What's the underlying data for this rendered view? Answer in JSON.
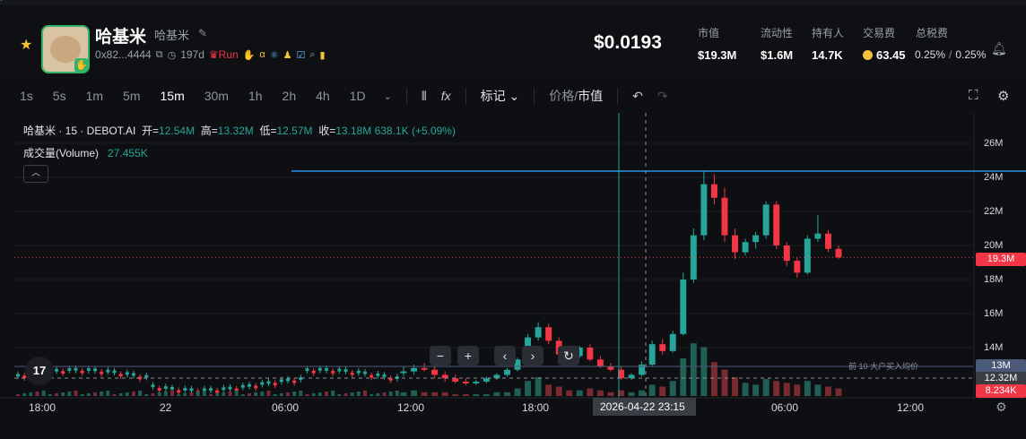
{
  "header": {
    "name": "哈基米",
    "sub_name": "哈基米",
    "address": "0x82...4444",
    "age": "197d",
    "run_label": "Run",
    "price": "$0.0193",
    "stats": [
      {
        "label": "市值",
        "value": "$19.3M"
      },
      {
        "label": "流动性",
        "value": "$1.6M"
      },
      {
        "label": "持有人",
        "value": "14.7K"
      },
      {
        "label": "交易费",
        "value": "63.45"
      },
      {
        "label": "总税费",
        "value": "0.25%",
        "value2": "0.25%"
      }
    ]
  },
  "toolbar": {
    "timeframes": [
      "1s",
      "5s",
      "1m",
      "5m",
      "15m",
      "30m",
      "1h",
      "2h",
      "4h",
      "1D"
    ],
    "active_timeframe": "15m",
    "marks_label": "标记",
    "price_label": "价格",
    "mcap_label": "市值"
  },
  "chart_info": {
    "symbol": "哈基米 · 15 · DEBOT.AI",
    "open_label": "开=",
    "open": "12.54M",
    "high_label": "高=",
    "high": "13.32M",
    "low_label": "低=",
    "low": "12.57M",
    "close_label": "收=",
    "close": "13.18M",
    "change": "638.1K (+5.09%)",
    "volume_label": "成交量(Volume)",
    "volume": "27.455K",
    "top_holders_label": "前 10 大户买入均价",
    "crosshair_time": "2026-04-22    23:15"
  },
  "chart_data": {
    "type": "candlestick",
    "y_ticks": [
      "26M",
      "24M",
      "22M",
      "20M",
      "18M",
      "16M",
      "14M"
    ],
    "x_ticks": [
      "18:00",
      "22",
      "06:00",
      "12:00",
      "18:00",
      "06:00",
      "12:00"
    ],
    "price_tags": {
      "current": "19.3M",
      "avg_buy": "13M",
      "crosshair": "12.32M",
      "volume": "8.234K"
    },
    "colors": {
      "up": "#26a69a",
      "down": "#f23645",
      "line": "#2b95e9"
    },
    "candles": [
      {
        "o": 12.5,
        "h": 12.9,
        "l": 12.3,
        "c": 12.6
      },
      {
        "o": 12.6,
        "h": 13.0,
        "l": 12.4,
        "c": 12.8
      },
      {
        "o": 12.8,
        "h": 13.1,
        "l": 12.6,
        "c": 12.7
      },
      {
        "o": 12.7,
        "h": 12.9,
        "l": 12.2,
        "c": 12.4
      },
      {
        "o": 12.4,
        "h": 12.6,
        "l": 12.0,
        "c": 12.2
      },
      {
        "o": 12.2,
        "h": 12.4,
        "l": 11.9,
        "c": 12.0
      },
      {
        "o": 12.0,
        "h": 12.2,
        "l": 11.8,
        "c": 11.9
      },
      {
        "o": 11.9,
        "h": 12.1,
        "l": 11.8,
        "c": 12.0
      },
      {
        "o": 12.0,
        "h": 12.3,
        "l": 11.9,
        "c": 12.2
      },
      {
        "o": 12.2,
        "h": 12.5,
        "l": 12.1,
        "c": 12.4
      },
      {
        "o": 12.4,
        "h": 12.8,
        "l": 12.3,
        "c": 12.7
      },
      {
        "o": 12.7,
        "h": 13.4,
        "l": 12.6,
        "c": 13.3
      },
      {
        "o": 13.3,
        "h": 14.8,
        "l": 13.2,
        "c": 14.6
      },
      {
        "o": 14.6,
        "h": 15.5,
        "l": 14.4,
        "c": 15.2
      },
      {
        "o": 15.2,
        "h": 15.4,
        "l": 14.2,
        "c": 14.4
      },
      {
        "o": 14.4,
        "h": 14.6,
        "l": 13.4,
        "c": 13.6
      },
      {
        "o": 13.6,
        "h": 13.8,
        "l": 13.2,
        "c": 13.5
      },
      {
        "o": 13.5,
        "h": 14.1,
        "l": 13.4,
        "c": 14.0
      },
      {
        "o": 14.0,
        "h": 14.2,
        "l": 13.2,
        "c": 13.3
      },
      {
        "o": 13.3,
        "h": 13.5,
        "l": 12.8,
        "c": 12.9
      },
      {
        "o": 12.9,
        "h": 13.1,
        "l": 12.6,
        "c": 12.7
      },
      {
        "o": 12.7,
        "h": 12.9,
        "l": 12.1,
        "c": 12.2
      },
      {
        "o": 12.2,
        "h": 12.5,
        "l": 12.1,
        "c": 12.4
      },
      {
        "o": 12.4,
        "h": 13.2,
        "l": 12.3,
        "c": 13.0
      },
      {
        "o": 13.0,
        "h": 14.4,
        "l": 12.9,
        "c": 14.2
      },
      {
        "o": 14.2,
        "h": 14.5,
        "l": 13.6,
        "c": 13.8
      },
      {
        "o": 13.8,
        "h": 15.0,
        "l": 13.7,
        "c": 14.8
      },
      {
        "o": 14.8,
        "h": 18.4,
        "l": 14.7,
        "c": 18.0
      },
      {
        "o": 18.0,
        "h": 21.0,
        "l": 17.8,
        "c": 20.6
      },
      {
        "o": 20.6,
        "h": 24.4,
        "l": 20.3,
        "c": 23.6
      },
      {
        "o": 23.6,
        "h": 24.2,
        "l": 22.4,
        "c": 22.8
      },
      {
        "o": 22.8,
        "h": 23.4,
        "l": 20.2,
        "c": 20.6
      },
      {
        "o": 20.6,
        "h": 21.0,
        "l": 19.2,
        "c": 19.6
      },
      {
        "o": 19.6,
        "h": 20.4,
        "l": 19.4,
        "c": 20.2
      },
      {
        "o": 20.2,
        "h": 20.8,
        "l": 19.8,
        "c": 20.6
      },
      {
        "o": 20.6,
        "h": 22.6,
        "l": 20.4,
        "c": 22.4
      },
      {
        "o": 22.4,
        "h": 22.6,
        "l": 19.8,
        "c": 20.0
      },
      {
        "o": 20.0,
        "h": 20.2,
        "l": 18.8,
        "c": 19.1
      },
      {
        "o": 19.1,
        "h": 19.3,
        "l": 18.1,
        "c": 18.4
      },
      {
        "o": 18.4,
        "h": 20.6,
        "l": 18.3,
        "c": 20.4
      },
      {
        "o": 20.4,
        "h": 21.8,
        "l": 20.2,
        "c": 20.7
      },
      {
        "o": 20.7,
        "h": 20.9,
        "l": 19.6,
        "c": 19.8
      },
      {
        "o": 19.8,
        "h": 20.0,
        "l": 19.2,
        "c": 19.3
      }
    ],
    "volumes": [
      2,
      3,
      2,
      2,
      2,
      1,
      1,
      1,
      1,
      2,
      2,
      4,
      8,
      10,
      6,
      5,
      3,
      3,
      4,
      3,
      2,
      3,
      2,
      3,
      6,
      5,
      8,
      20,
      28,
      26,
      18,
      14,
      10,
      7,
      6,
      9,
      8,
      7,
      6,
      8,
      6,
      5,
      4
    ]
  }
}
